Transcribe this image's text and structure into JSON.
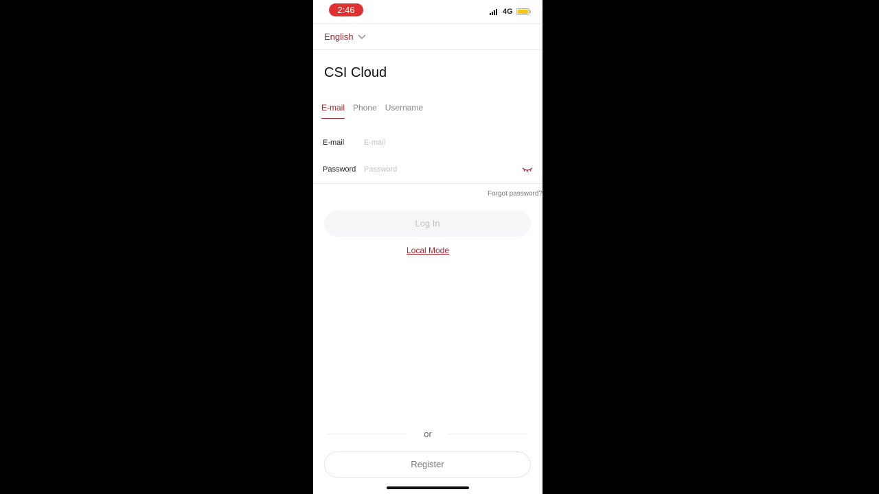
{
  "status_bar": {
    "time": "2:46",
    "network": "4G"
  },
  "language_selector": {
    "label": "English",
    "icon": "chevron-down-icon"
  },
  "app_title": "CSI Cloud",
  "login_tabs": [
    {
      "label": "E-mail",
      "active": true
    },
    {
      "label": "Phone",
      "active": false
    },
    {
      "label": "Username",
      "active": false
    }
  ],
  "form": {
    "email_label": "E-mail",
    "email_placeholder": "E-mail",
    "email_value": "",
    "password_label": "Password",
    "password_placeholder": "Password",
    "password_value": "",
    "password_toggle_icon": "eye-closed-icon",
    "forgot_password": "Forgot password?"
  },
  "login_button": "Log In",
  "local_mode_link": "Local Mode",
  "divider_text": "or",
  "register_button": "Register",
  "colors": {
    "accent": "#b0202a",
    "status_pill": "#e0302f",
    "disabled_button_bg": "#f6f6f8",
    "battery": "#f5c518"
  }
}
